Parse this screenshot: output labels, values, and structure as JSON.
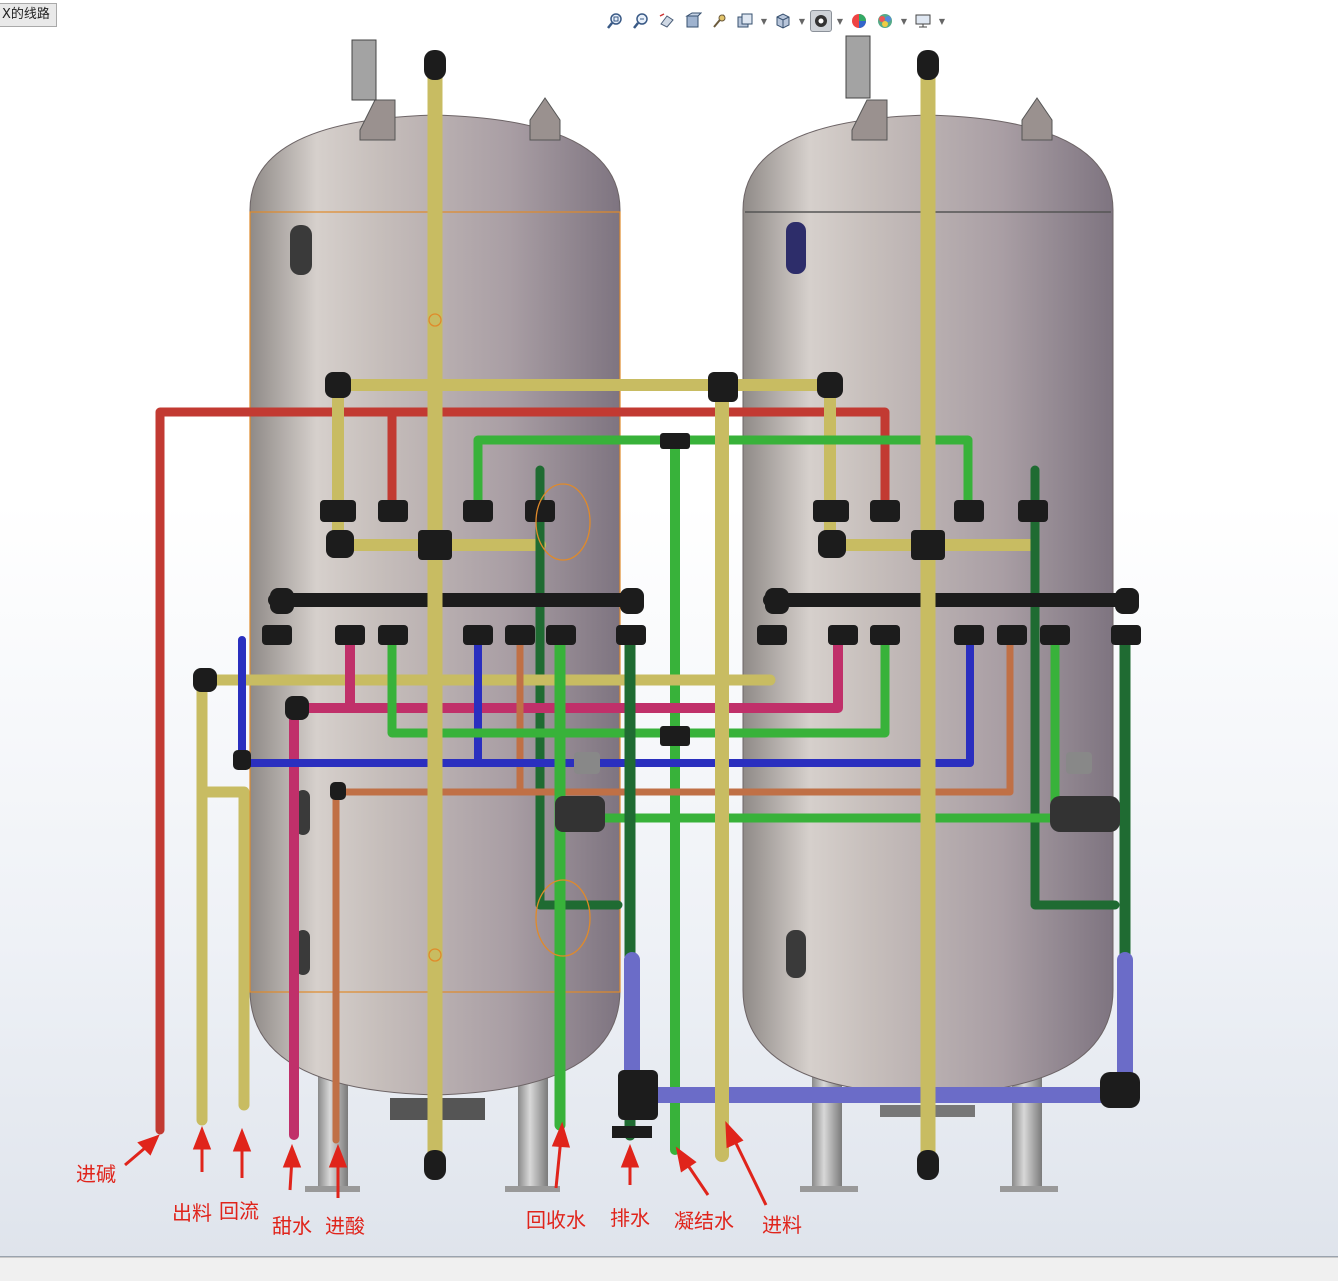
{
  "window": {
    "title_tab": "X的线路"
  },
  "toolbar": {
    "icons": [
      "zoom-to-fit-icon",
      "zoom-to-area-icon",
      "previous-view-icon",
      "section-view-icon",
      "view-orientation-icon",
      "display-style-icon",
      "hide-show-items-icon",
      "edit-appearance-icon",
      "apply-scene-icon",
      "view-settings-icon",
      "display-monitor-icon"
    ],
    "active": "hide-show-items-icon"
  },
  "colors": {
    "tank": "#b9b0ad",
    "yellow_pipe": "#c8bc62",
    "red_pipe": "#c23a32",
    "green_pipe": "#38b23a",
    "dark_green_pipe": "#1f6b32",
    "blue_pipe": "#2a2fbf",
    "magenta_pipe": "#c0306a",
    "pink_pipe": "#e060b0",
    "orange_pipe": "#c07046",
    "lavender_pipe": "#6b6cc8",
    "fitting": "#1c1c1c",
    "annotation": "#e0241b"
  },
  "labels": {
    "alkali_in": "进碱",
    "discharge": "出料",
    "reflux": "回流",
    "sweet_water": "甜水",
    "acid_in": "进酸",
    "recovered_water": "回收水",
    "drain": "排水",
    "condensate": "凝结水",
    "feed_in": "进料"
  }
}
